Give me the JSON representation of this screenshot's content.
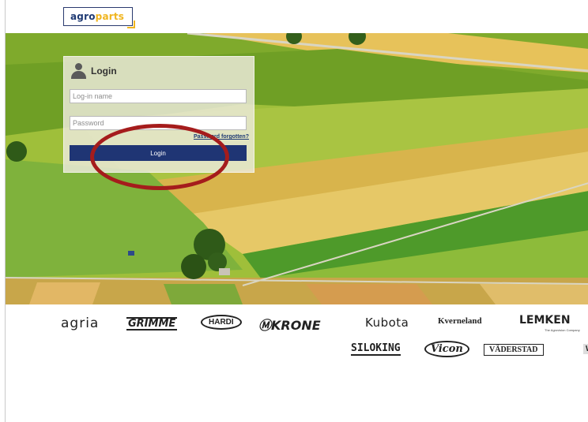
{
  "header": {
    "logo_part1": "agro",
    "logo_part2": "parts"
  },
  "login": {
    "title": "Login",
    "username_placeholder": "Log-in name",
    "password_placeholder": "Password",
    "forgot_link": "Password forgotten?",
    "button_label": "Login"
  },
  "brands": {
    "agria": "agria",
    "grimme": "GRIMME",
    "hardi": "HARDI",
    "krone": "ⓂKRONE",
    "kubota": "Kubota",
    "kverneland": "Kverneland",
    "lemken": "LEMKEN",
    "lemken_sub": "The Agrovision Company",
    "siloking": "SILOKING",
    "vicon": "Vicon",
    "vaderstad": "VÄDERSTAD",
    "w": "W"
  },
  "colors": {
    "brand_blue": "#1f3574",
    "brand_yellow": "#f0b51f",
    "annotation_red": "#a51c1c"
  },
  "icons": {
    "user": "user-icon"
  }
}
